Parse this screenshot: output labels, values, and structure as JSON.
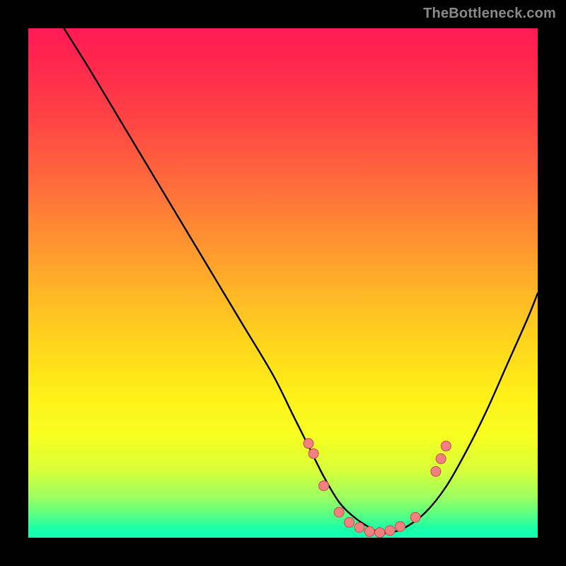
{
  "watermark": {
    "text": "TheBottleneck.com"
  },
  "colors": {
    "background": "#000000",
    "curve_stroke": "#000000",
    "marker_fill": "#f28080",
    "marker_stroke": "#c84a4a"
  },
  "chart_data": {
    "type": "line",
    "title": "",
    "xlabel": "",
    "ylabel": "",
    "xlim": [
      0,
      100
    ],
    "ylim": [
      0,
      100
    ],
    "grid": false,
    "legend": false,
    "series": [
      {
        "name": "bottleneck-curve",
        "x": [
          7,
          12,
          18,
          24,
          30,
          36,
          42,
          48,
          52,
          55,
          58,
          61,
          64,
          67,
          69,
          71,
          74,
          78,
          82,
          86,
          90,
          94,
          98,
          100
        ],
        "y": [
          100,
          92,
          82,
          72,
          62,
          52,
          42,
          32,
          24,
          18,
          12,
          7,
          4,
          2,
          1,
          1,
          2,
          5,
          10,
          17,
          25,
          34,
          43,
          48
        ]
      }
    ],
    "markers": {
      "name": "highlighted-points",
      "x": [
        55,
        56,
        58,
        61,
        63,
        65,
        67,
        69,
        71,
        73,
        76,
        80,
        81,
        82
      ],
      "y": [
        18.5,
        16.5,
        10.2,
        5.0,
        3.0,
        2.0,
        1.2,
        1.0,
        1.4,
        2.2,
        4.0,
        13.0,
        15.5,
        18.0
      ]
    }
  }
}
